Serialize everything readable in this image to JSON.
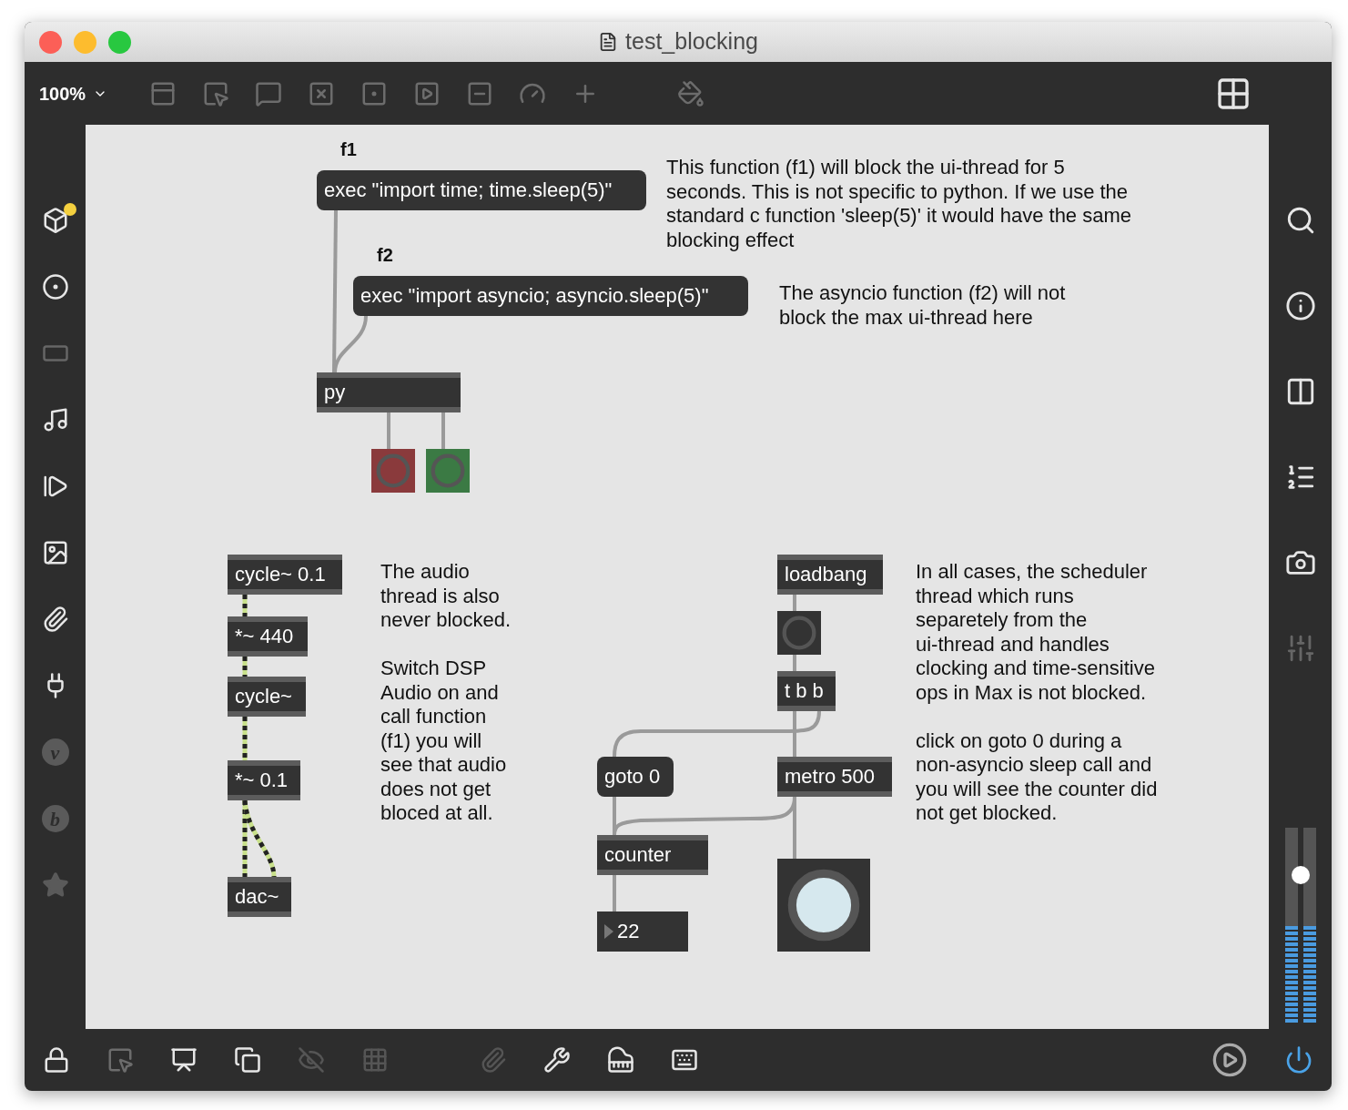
{
  "window": {
    "title": "test_blocking"
  },
  "toolbar": {
    "zoom": "100%"
  },
  "left_sidebar": {
    "badges": [
      "v",
      "b"
    ]
  },
  "right_sidebar": {
    "gain": {
      "level": 0.76
    }
  },
  "patch": {
    "objects": [
      {
        "kind": "label",
        "text": "f1"
      },
      {
        "kind": "message",
        "text": "exec \"import time; time.sleep(5)\""
      },
      {
        "kind": "comment",
        "text": "This function (f1) will block the ui-thread for 5\nseconds. This is not specific to python. If we use the\nstandard c function 'sleep(5)' it would have the same\nblocking effect"
      },
      {
        "kind": "label",
        "text": "f2"
      },
      {
        "kind": "message",
        "text": "exec \"import asyncio; asyncio.sleep(5)\""
      },
      {
        "kind": "comment",
        "text": "The asyncio function (f2) will not\nblock the max ui-thread here"
      },
      {
        "kind": "object",
        "text": "py"
      },
      {
        "kind": "button",
        "color": "#8a3a3c",
        "lit": false
      },
      {
        "kind": "button",
        "color": "#3b7a44",
        "lit": false
      },
      {
        "kind": "object",
        "text": "cycle~ 0.1"
      },
      {
        "kind": "object",
        "text": "*~ 440"
      },
      {
        "kind": "object",
        "text": "cycle~"
      },
      {
        "kind": "object",
        "text": "*~ 0.1"
      },
      {
        "kind": "object",
        "text": "dac~"
      },
      {
        "kind": "comment",
        "text": "The audio\nthread is also\nnever blocked.\n\nSwitch DSP\nAudio on and\ncall function\n(f1) you will\nsee that audio\ndoes not get\nbloced at all."
      },
      {
        "kind": "object",
        "text": "loadbang"
      },
      {
        "kind": "button",
        "color": "#333333",
        "lit": false
      },
      {
        "kind": "object",
        "text": "t b b"
      },
      {
        "kind": "message",
        "text": "goto 0"
      },
      {
        "kind": "object",
        "text": "metro 500"
      },
      {
        "kind": "object",
        "text": "counter"
      },
      {
        "kind": "number",
        "text": "22"
      },
      {
        "kind": "button",
        "color": "#333333",
        "lit": true
      },
      {
        "kind": "comment",
        "text": "In all cases, the scheduler\nthread which runs\nseparetely from the\nui-thread and handles\nclocking and time-sensitive\nops in Max is not blocked.\n\nclick on goto 0 during a\nnon-asyncio sleep call and\nyou will see the counter did\nnot get blocked."
      }
    ]
  }
}
